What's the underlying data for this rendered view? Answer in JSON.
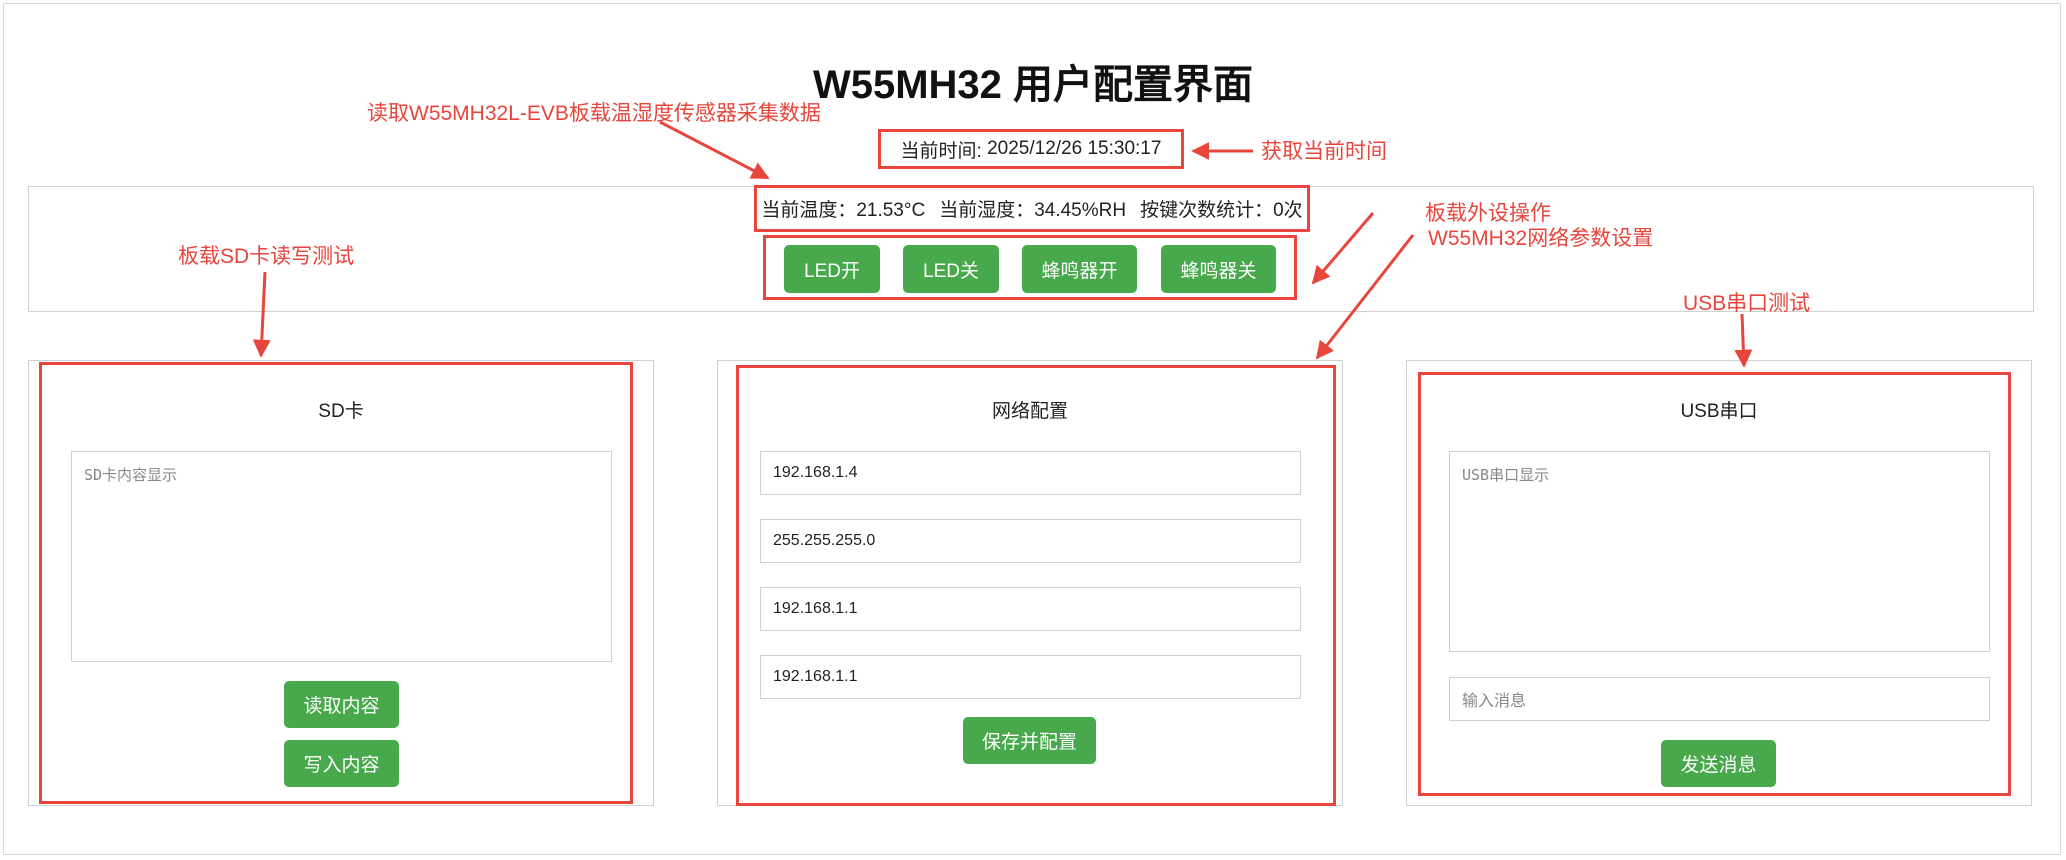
{
  "header": {
    "title": "W55MH32 用户配置界面"
  },
  "clock": {
    "label": "当前时间:",
    "value": "2025/12/26 15:30:17"
  },
  "sensors": {
    "temperature": "当前温度：21.53°C",
    "humidity": "当前湿度：34.45%RH",
    "key_count": "按键次数统计：0次"
  },
  "controls": {
    "led_on": "LED开",
    "led_off": "LED关",
    "buzzer_on": "蜂鸣器开",
    "buzzer_off": "蜂鸣器关"
  },
  "sd_card": {
    "title": "SD卡",
    "textarea_placeholder": "SD卡内容显示",
    "read_button": "读取内容",
    "write_button": "写入内容"
  },
  "network": {
    "title": "网络配置",
    "fields": [
      "192.168.1.4",
      "255.255.255.0",
      "192.168.1.1",
      "192.168.1.1"
    ],
    "save_button": "保存并配置"
  },
  "usb_serial": {
    "title": "USB串口",
    "textarea_placeholder": "USB串口显示",
    "input_placeholder": "输入消息",
    "send_button": "发送消息"
  },
  "annotations": {
    "sensor_note": "读取W55MH32L-EVB板载温湿度传感器采集数据",
    "time_note": "获取当前时间",
    "peripheral_note": "板载外设操作",
    "network_note": "W55MH32网络参数设置",
    "sd_note": "板载SD卡读写测试",
    "usb_note": "USB串口测试"
  },
  "colors": {
    "accent_green": "#47a94b",
    "annotation_red": "#e8453c"
  }
}
